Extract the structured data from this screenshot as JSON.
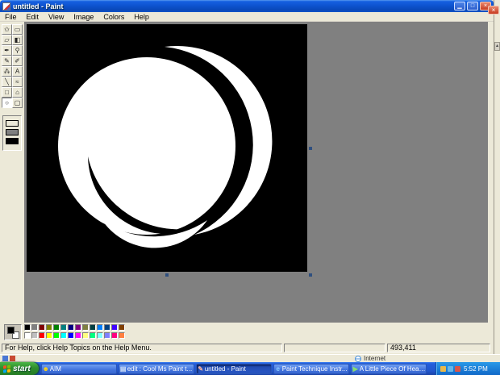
{
  "window": {
    "title": "untitled - Paint",
    "minimize_glyph": "▁",
    "maximize_glyph": "□",
    "close_glyph": "×",
    "background_close_glyph": "×",
    "titlebar_color": "#0A50D0",
    "close_button_color": "#D8553F"
  },
  "menu": {
    "items": [
      "File",
      "Edit",
      "View",
      "Image",
      "Colors",
      "Help"
    ]
  },
  "toolbox": {
    "selected_tool": "ellipse",
    "tools": [
      {
        "name": "free-form-select",
        "glyph": "✩"
      },
      {
        "name": "select",
        "glyph": "▭"
      },
      {
        "name": "eraser",
        "glyph": "▱"
      },
      {
        "name": "fill-with-color",
        "glyph": "◧"
      },
      {
        "name": "pick-color",
        "glyph": "✒"
      },
      {
        "name": "magnifier",
        "glyph": "⚲"
      },
      {
        "name": "pencil",
        "glyph": "✎"
      },
      {
        "name": "brush",
        "glyph": "✐"
      },
      {
        "name": "airbrush",
        "glyph": "⁂"
      },
      {
        "name": "text",
        "glyph": "A"
      },
      {
        "name": "line",
        "glyph": "╲"
      },
      {
        "name": "curve",
        "glyph": "≈"
      },
      {
        "name": "rectangle",
        "glyph": "□"
      },
      {
        "name": "polygon",
        "glyph": "⌂"
      },
      {
        "name": "ellipse",
        "glyph": "○"
      },
      {
        "name": "rounded-rectangle",
        "glyph": "▢"
      }
    ],
    "fill_styles": [
      "outline",
      "outline-with-fill",
      "solid-fill"
    ]
  },
  "canvas": {
    "background_color": "#000000",
    "drawing_color": "#ffffff"
  },
  "palette": {
    "foreground": "#000000",
    "background": "#ffffff",
    "rows": [
      [
        "#000000",
        "#808080",
        "#800000",
        "#808000",
        "#008000",
        "#008080",
        "#000080",
        "#800080",
        "#808040",
        "#004040",
        "#0080FF",
        "#004080",
        "#4000FF",
        "#804000"
      ],
      [
        "#FFFFFF",
        "#C0C0C0",
        "#FF0000",
        "#FFFF00",
        "#00FF00",
        "#00FFFF",
        "#0000FF",
        "#FF00FF",
        "#FFFF80",
        "#00FF80",
        "#80FFFF",
        "#8080FF",
        "#FF0080",
        "#FF8040"
      ]
    ]
  },
  "statusbar": {
    "help_text": "For Help, click Help Topics on the Help Menu.",
    "coordinates": "493,411"
  },
  "background_window": {
    "zone_label": "Internet",
    "scroll_up_glyph": "▴"
  },
  "taskbar": {
    "start_label": "start",
    "start_flag_colors": [
      "#f35325",
      "#81bc06",
      "#05a6f0",
      "#ffba08"
    ],
    "tasks": [
      {
        "label": "AIM",
        "icon": "aim-icon",
        "glyph": "☻",
        "color": "#ffd415",
        "active": false
      },
      {
        "label": "edit : Cool Ms Paint t...",
        "icon": "document-icon",
        "glyph": "▤",
        "color": "#cfe0f8",
        "active": false
      },
      {
        "label": "untitled - Paint",
        "icon": "paint-icon",
        "glyph": "✎",
        "color": "#f0b0a0",
        "active": true
      },
      {
        "label": "Paint Technique Instr...",
        "icon": "internet-explorer-icon",
        "glyph": "e",
        "color": "#8fd0ff",
        "active": false
      },
      {
        "label": "A Little Piece Of Heaven",
        "icon": "media-player-icon",
        "glyph": "▶",
        "color": "#86df70",
        "active": false
      }
    ],
    "tray_icons": [
      {
        "color": "#e8b84b"
      },
      {
        "color": "#67b7e8"
      },
      {
        "color": "#d9564a"
      }
    ],
    "clock": "5:52 PM"
  }
}
